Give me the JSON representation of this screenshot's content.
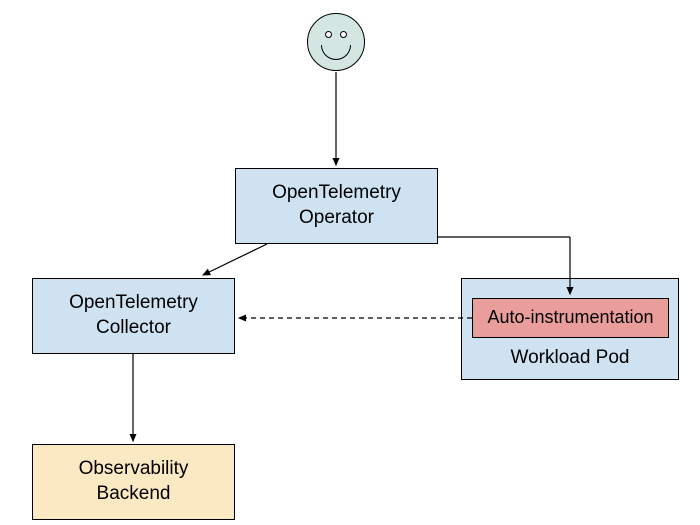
{
  "nodes": {
    "user": {
      "type": "smiley"
    },
    "operator": {
      "label": "OpenTelemetry\nOperator"
    },
    "collector": {
      "label": "OpenTelemetry\nCollector"
    },
    "workload_pod": {
      "label": "Workload Pod"
    },
    "auto_instrumentation": {
      "label": "Auto-instrumentation"
    },
    "backend": {
      "label": "Observability\nBackend"
    }
  },
  "colors": {
    "blue": "#cee2f2",
    "yellow": "#fbe9c3",
    "red": "#ea9e9c",
    "smiley": "#d4e6e2"
  }
}
